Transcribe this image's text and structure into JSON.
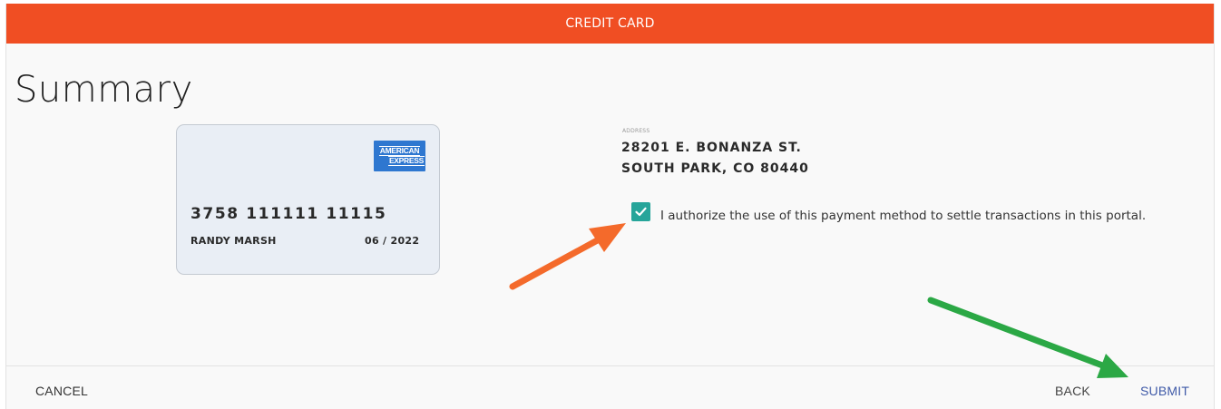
{
  "header": {
    "title": "CREDIT CARD"
  },
  "page": {
    "title": "Summary"
  },
  "card": {
    "brand_line1": "AMERICAN",
    "brand_line2": "EXPRESS",
    "number": "3758 111111 11115",
    "holder": "RANDY MARSH",
    "expiry": "06 / 2022",
    "colors": {
      "background": "#e9eef5",
      "brand": "#2e77d0"
    }
  },
  "address": {
    "label": "ADDRESS",
    "line1": "28201 E. BONANZA ST.",
    "line2": "SOUTH PARK, CO 80440"
  },
  "authorization": {
    "checked": true,
    "text": "I authorize the use of this payment method to settle transactions in this portal.",
    "icon": "checkmark-icon",
    "color": "#26a59a"
  },
  "footer": {
    "cancel_label": "CANCEL",
    "back_label": "BACK",
    "submit_label": "SUBMIT"
  },
  "annotations": {
    "arrows": [
      {
        "icon": "orange-arrow-icon",
        "color": "#f46a2b",
        "points_to": "authorize-checkbox"
      },
      {
        "icon": "green-arrow-icon",
        "color": "#2ba845",
        "points_to": "submit-button"
      }
    ]
  },
  "colors": {
    "accent": "#f04e23",
    "link": "#3f5aa8"
  }
}
